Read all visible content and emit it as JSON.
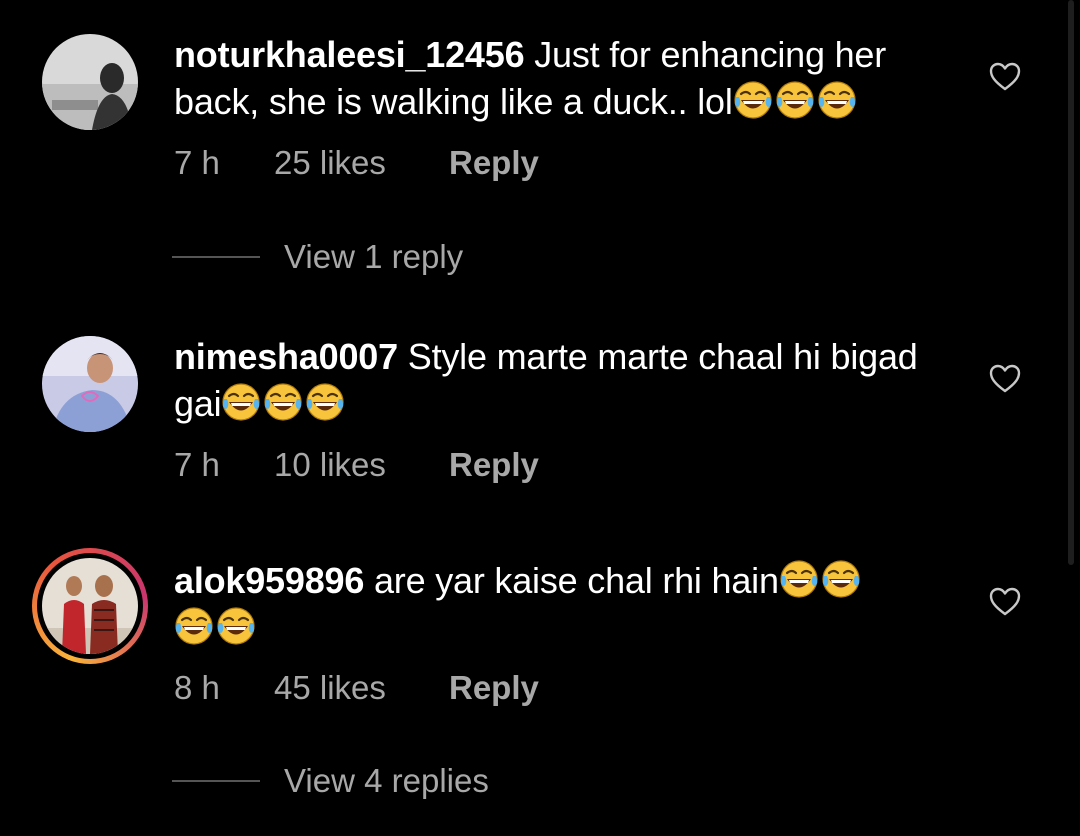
{
  "comments": [
    {
      "username": "noturkhaleesi_12456",
      "text": "Just for enhancing her back, she is walking like a duck.. lol",
      "emoji_count": 3,
      "time": "7 h",
      "likes": "25 likes",
      "reply_label": "Reply",
      "view_replies": "View 1 reply"
    },
    {
      "username": "nimesha0007",
      "text": "Style marte marte chaal hi bigad gai",
      "emoji_count": 3,
      "time": "7 h",
      "likes": "10 likes",
      "reply_label": "Reply"
    },
    {
      "username": "alok959896",
      "text": "are yar kaise chal rhi hain",
      "emoji_count": 4,
      "time": "8 h",
      "likes": "45 likes",
      "reply_label": "Reply",
      "view_replies": "View 4 replies"
    }
  ],
  "icons": {
    "like": "heart-outline-icon",
    "emoji": "face-with-tears-of-joy-icon"
  },
  "colors": {
    "background": "#000000",
    "text": "#ffffff",
    "secondary_text": "#a8a8a8",
    "story_ring": [
      "#f9b43a",
      "#e8553e",
      "#c9356e"
    ]
  }
}
